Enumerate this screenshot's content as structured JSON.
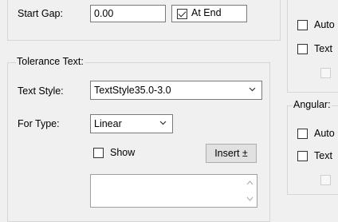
{
  "top_section": {
    "start_gap_label": "Start Gap:",
    "start_gap_value": "0.00",
    "at_end_label": "At End",
    "at_end_checked": true
  },
  "tolerance_text": {
    "legend": "Tolerance Text:",
    "text_style_label": "Text Style:",
    "text_style_value": "TextStyle35.0-3.0",
    "for_type_label": "For Type:",
    "for_type_value": "Linear",
    "show_label": "Show",
    "show_checked": false,
    "insert_button_label": "Insert ±",
    "text_area_value": ""
  },
  "right_upper_group": {
    "items": [
      {
        "label": "Auto",
        "checked": false,
        "enabled": true
      },
      {
        "label": "Text",
        "checked": false,
        "enabled": true
      },
      {
        "label": "",
        "checked": false,
        "enabled": false
      }
    ]
  },
  "angular_group": {
    "legend": "Angular:",
    "items": [
      {
        "label": "Auto",
        "checked": false,
        "enabled": true
      },
      {
        "label": "Text",
        "checked": false,
        "enabled": true
      },
      {
        "label": "",
        "checked": false,
        "enabled": false
      }
    ]
  },
  "icons": {
    "dropdown": "chevron-down-icon",
    "scroll_up": "chevron-up-icon",
    "scroll_down": "chevron-down-icon"
  },
  "colors": {
    "background": "#f0f0f0",
    "group_border": "#d6d6d6",
    "field_border": "#7a7a7a",
    "button_bg": "#e1e1e1"
  }
}
